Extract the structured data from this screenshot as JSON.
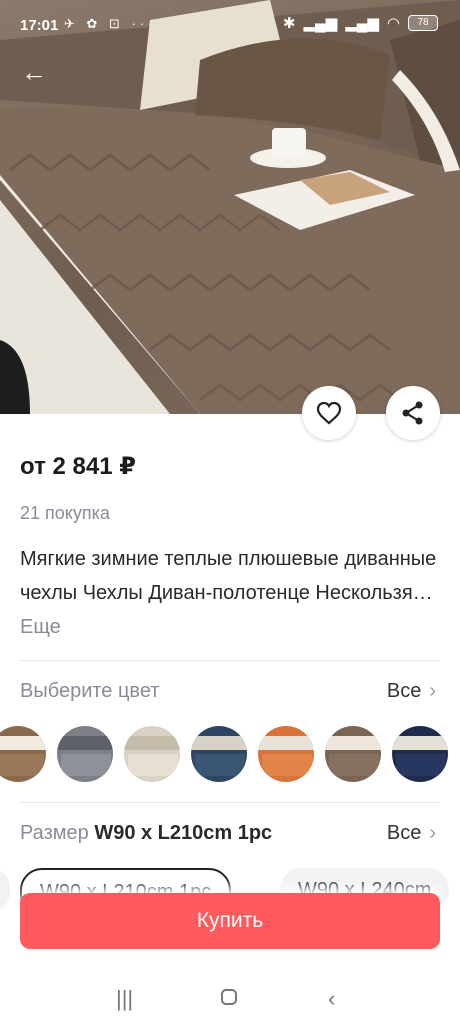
{
  "status_bar": {
    "time": "17:01",
    "left_icons": "✈ ✿ ⊡ ···",
    "battery": "78"
  },
  "product": {
    "price": "от 2 841 ₽",
    "purchases": "21 покупка",
    "title": "Мягкие зимние теплые плюшевые диванные чехлы Чехлы Диван-полотенце Нескользя…",
    "more_label": "Еще"
  },
  "color_section": {
    "label": "Выберите цвет",
    "all_label": "Все",
    "swatch_colors": [
      "#8a6a4c",
      "#7b7f86",
      "#d9d1c3",
      "#2f4662",
      "#d8743a",
      "#7a6555",
      "#1f2b4a"
    ]
  },
  "size_section": {
    "label": "Размер",
    "value": "W90 x L210cm 1pc",
    "all_label": "Все",
    "options": [
      "W90 x L210cm 1pc",
      "W90 x L240cm"
    ]
  },
  "buy_button": {
    "label": "Купить"
  },
  "colors": {
    "accent": "#ff5b5e",
    "muted": "#8a8a99"
  }
}
